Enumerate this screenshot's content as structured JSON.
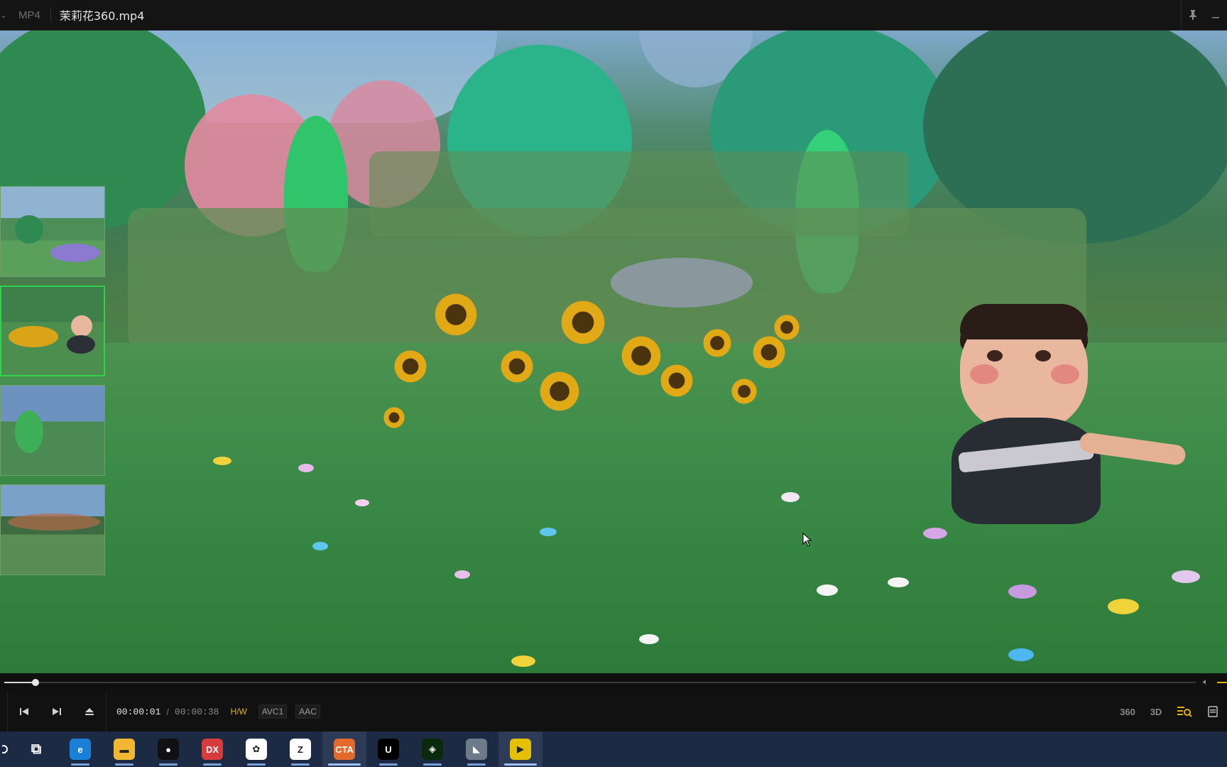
{
  "titlebar": {
    "format": "MP4",
    "filename": "茉莉花360.mp4",
    "icons": {
      "pin": "pin-icon",
      "minimize": "minimize-icon"
    }
  },
  "thumbnails": [
    {
      "label": "scene-1",
      "active": false
    },
    {
      "label": "scene-2",
      "active": true
    },
    {
      "label": "scene-3",
      "active": false
    },
    {
      "label": "scene-4",
      "active": false
    }
  ],
  "playback": {
    "current_time": "00:00:01",
    "separator": "/",
    "duration": "00:00:38",
    "progress_fraction": 0.026,
    "hw_tag": "H/W",
    "video_codec": "AVC1",
    "audio_codec": "AAC"
  },
  "controls": {
    "prev": "previous-icon",
    "next": "next-icon",
    "eject": "eject-icon",
    "right": {
      "vr360": "360",
      "three_d": "3D"
    }
  },
  "colors": {
    "accent": "#e0b000",
    "thumb_active": "#2fd24a",
    "taskbar": "#1c2a44"
  },
  "taskbar": [
    {
      "name": "task-view",
      "glyph": "⧉",
      "bg": "#1c2a44",
      "active": false
    },
    {
      "name": "edge",
      "glyph": "e",
      "bg": "#1a7fd6",
      "active": false
    },
    {
      "name": "file-explorer",
      "glyph": "▬",
      "bg": "#f2b730",
      "active": false
    },
    {
      "name": "recorder",
      "glyph": "●",
      "bg": "#111111",
      "active": false
    },
    {
      "name": "dx-app",
      "glyph": "DX",
      "bg": "#d63c3c",
      "active": false
    },
    {
      "name": "cloud-app",
      "glyph": "✿",
      "bg": "#ffffff",
      "active": false
    },
    {
      "name": "zbrush",
      "glyph": "Z",
      "bg": "#ffffff",
      "active": false
    },
    {
      "name": "cta-app",
      "glyph": "CTA",
      "bg": "#e36a2a",
      "active": true
    },
    {
      "name": "unreal-engine",
      "glyph": "U",
      "bg": "#000000",
      "active": false
    },
    {
      "name": "green-app",
      "glyph": "◈",
      "bg": "#0b2a0b",
      "active": false
    },
    {
      "name": "gray-app",
      "glyph": "◣",
      "bg": "#6e7a88",
      "active": false
    },
    {
      "name": "video-player",
      "glyph": "▶",
      "bg": "#e3c000",
      "active": true
    }
  ]
}
